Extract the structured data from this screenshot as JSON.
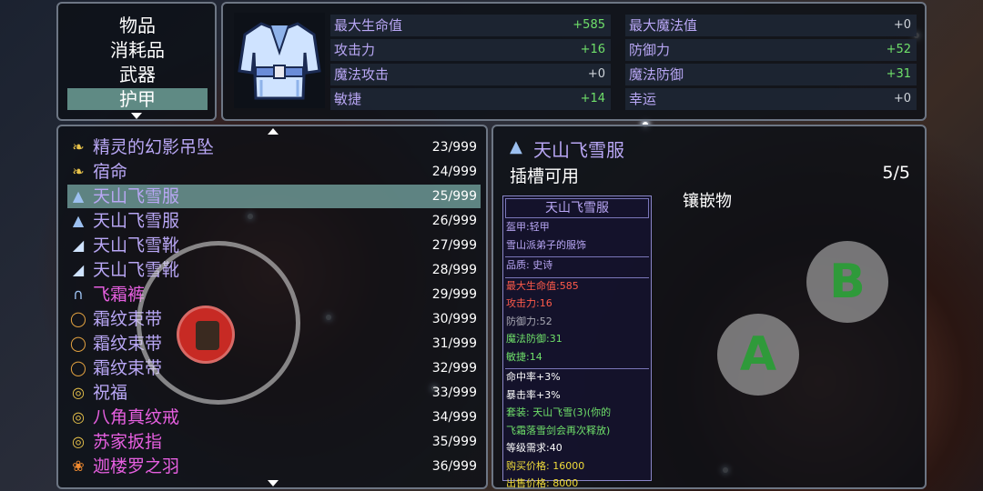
{
  "categories": {
    "items": [
      "物品",
      "消耗品",
      "武器",
      "护甲"
    ],
    "selected_index": 3
  },
  "stats": {
    "left": [
      {
        "name": "最大生命值",
        "value": "+585",
        "positive": true
      },
      {
        "name": "攻击力",
        "value": "+16",
        "positive": true
      },
      {
        "name": "魔法攻击",
        "value": "+0",
        "positive": false
      },
      {
        "name": "敏捷",
        "value": "+14",
        "positive": true
      }
    ],
    "right": [
      {
        "name": "最大魔法值",
        "value": "+0",
        "positive": false
      },
      {
        "name": "防御力",
        "value": "+52",
        "positive": true
      },
      {
        "name": "魔法防御",
        "value": "+31",
        "positive": true
      },
      {
        "name": "幸运",
        "value": "+0",
        "positive": false
      }
    ]
  },
  "items": [
    {
      "icon": "pendant-icon",
      "name": "精灵的幻影吊坠",
      "count": "23/999",
      "color": "purple"
    },
    {
      "icon": "pendant-icon",
      "name": "宿命",
      "count": "24/999",
      "color": "purple"
    },
    {
      "icon": "robe-icon",
      "name": "天山飞雪服",
      "count": "25/999",
      "color": "purple",
      "selected": true
    },
    {
      "icon": "robe-icon",
      "name": "天山飞雪服",
      "count": "26/999",
      "color": "purple"
    },
    {
      "icon": "boots-icon",
      "name": "天山飞雪靴",
      "count": "27/999",
      "color": "purple"
    },
    {
      "icon": "boots-icon",
      "name": "天山飞雪靴",
      "count": "28/999",
      "color": "purple"
    },
    {
      "icon": "pants-icon",
      "name": "飞霜裤",
      "count": "29/999",
      "color": "pink"
    },
    {
      "icon": "belt-icon",
      "name": "霜纹束带",
      "count": "30/999",
      "color": "purple"
    },
    {
      "icon": "belt-icon",
      "name": "霜纹束带",
      "count": "31/999",
      "color": "purple"
    },
    {
      "icon": "belt-icon",
      "name": "霜纹束带",
      "count": "32/999",
      "color": "purple"
    },
    {
      "icon": "ring-icon",
      "name": "祝福",
      "count": "33/999",
      "color": "purple"
    },
    {
      "icon": "ring-icon",
      "name": "八角真纹戒",
      "count": "34/999",
      "color": "pink"
    },
    {
      "icon": "ring-icon",
      "name": "苏家扳指",
      "count": "35/999",
      "color": "pink"
    },
    {
      "icon": "feather-icon",
      "name": "迦楼罗之羽",
      "count": "36/999",
      "color": "pink"
    }
  ],
  "detail": {
    "title": "天山飞雪服",
    "slot_label": "插槽可用",
    "slot_count": "5/5",
    "inlay_label": "镶嵌物",
    "tooltip": {
      "header": "天山飞雪服",
      "lines_top": [
        {
          "text": "盔甲:轻甲",
          "color": "purple"
        },
        {
          "text": "雪山派弟子的服饰",
          "color": "purple"
        }
      ],
      "lines_mid": [
        {
          "text": "品质: 史诗",
          "color": "purple"
        }
      ],
      "lines_stats": [
        {
          "text": "最大生命值:585",
          "color": "red"
        },
        {
          "text": "攻击力:16",
          "color": "red"
        },
        {
          "text": "防御力:52",
          "color": "grey"
        },
        {
          "text": "魔法防御:31",
          "color": "green"
        },
        {
          "text": "敏捷:14",
          "color": "green"
        }
      ],
      "lines_bottom": [
        {
          "text": "命中率+3%",
          "color": "white"
        },
        {
          "text": "暴击率+3%",
          "color": "white"
        },
        {
          "text": "套装: 天山飞雪(3)(你的",
          "color": "green"
        },
        {
          "text": "飞霜落雪剑会再次释放)",
          "color": "green"
        },
        {
          "text": "等级需求:40",
          "color": "white"
        },
        {
          "text": "购买价格: 16000",
          "color": "yellow"
        },
        {
          "text": "出售价格: 8000",
          "color": "yellow"
        }
      ]
    }
  },
  "buttons": {
    "a": "A",
    "b": "B"
  },
  "colors": {
    "accent_select": "#5f8a84",
    "stat_name": "#b9a7f5",
    "positive": "#6fe06a",
    "pink": "#e65fe0"
  }
}
